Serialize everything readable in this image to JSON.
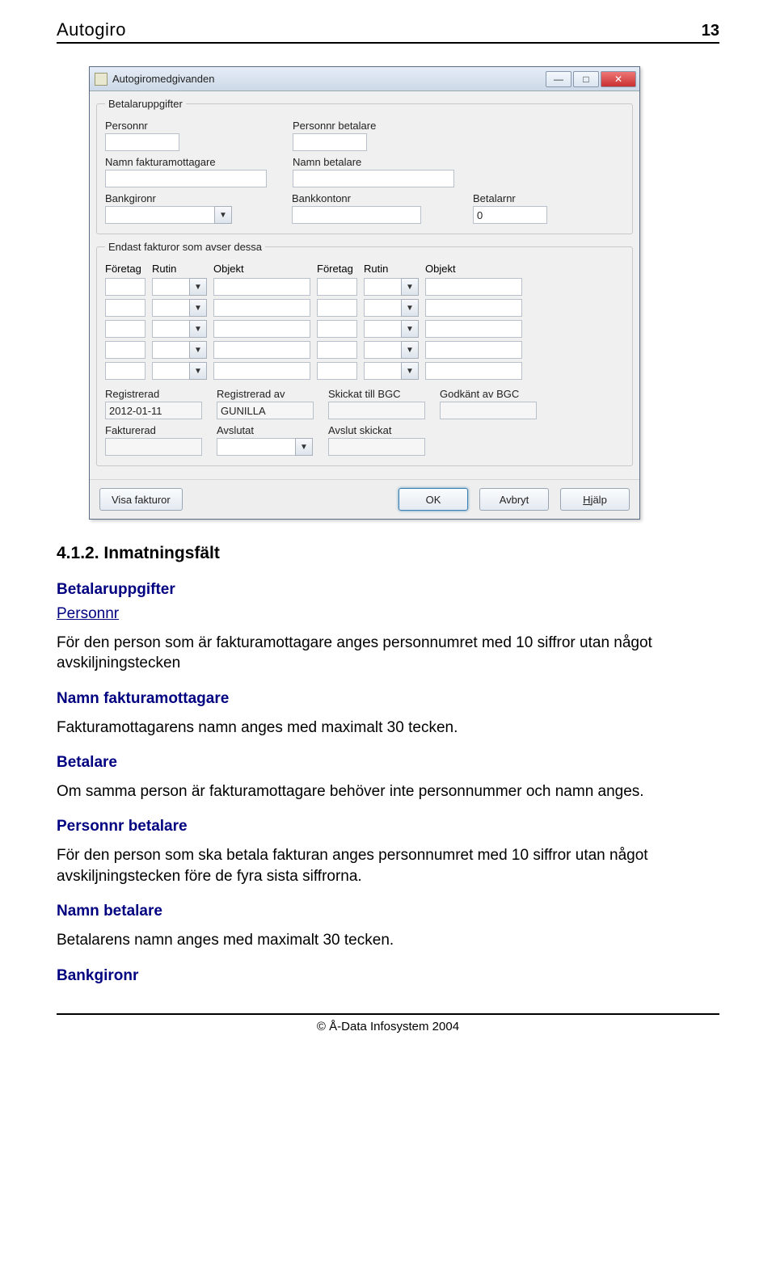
{
  "header": {
    "title": "Autogiro",
    "page": "13"
  },
  "footer": {
    "copyright": "© Å-Data Infosystem 2004"
  },
  "window": {
    "title": "Autogiromedgivanden",
    "groups": {
      "payer": {
        "legend": "Betalaruppgifter",
        "fields": {
          "personnr": "Personnr",
          "personnr_betalare": "Personnr betalare",
          "namn_fakturamottagare": "Namn fakturamottagare",
          "namn_betalare": "Namn betalare",
          "bankgironr": "Bankgironr",
          "bankkontonr": "Bankkontonr",
          "betalarnr": "Betalarnr",
          "betalarnr_value": "0"
        }
      },
      "invoices": {
        "legend": "Endast fakturor som avser dessa",
        "cols": [
          "Företag",
          "Rutin",
          "Objekt",
          "Företag",
          "Rutin",
          "Objekt"
        ],
        "row_count": 5
      },
      "status": {
        "registrerad": "Registrerad",
        "registrerad_value": "2012-01-11",
        "registrerad_av": "Registrerad av",
        "registrerad_av_value": "GUNILLA",
        "skickat_bgc": "Skickat till BGC",
        "godkant_bgc": "Godkänt av BGC",
        "fakturerad": "Fakturerad",
        "avslutat": "Avslutat",
        "avslut_skickat": "Avslut skickat"
      }
    },
    "buttons": {
      "visa": "Visa fakturor",
      "ok": "OK",
      "avbryt": "Avbryt",
      "hjalp_prefix": "H",
      "hjalp_rest": "jälp"
    }
  },
  "doc": {
    "h_num": "4.1.2. Inmatningsfält",
    "sec1_title": "Betalaruppgifter",
    "sec1_sub1": "Personnr",
    "sec1_p1": "För den person som är fakturamottagare anges personnumret med 10 siffror utan något avskiljningstecken",
    "sec2_title": "Namn fakturamottagare",
    "sec2_p1": "Fakturamottagarens namn anges med maximalt 30 tecken.",
    "sec3_title": "Betalare",
    "sec3_p1": "Om samma person är fakturamottagare behöver inte personnummer och namn anges.",
    "sec4_title": "Personnr betalare",
    "sec4_p1": "För den person som ska betala fakturan anges personnumret med 10 siffror utan något avskiljningstecken före de fyra sista siffrorna.",
    "sec5_title": "Namn betalare",
    "sec5_p1": "Betalarens namn anges med maximalt 30 tecken.",
    "sec6_title": "Bankgironr"
  }
}
